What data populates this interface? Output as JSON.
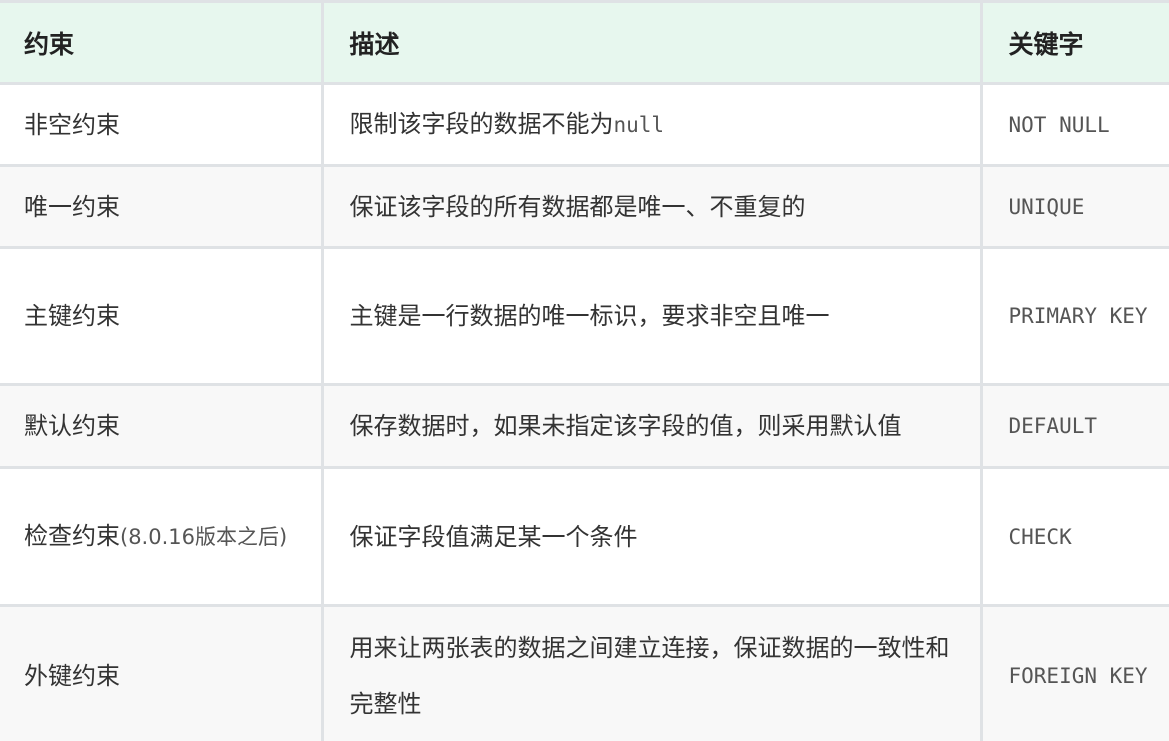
{
  "table": {
    "headers": {
      "constraint": "约束",
      "description": "描述",
      "keyword": "关键字"
    },
    "rows": [
      {
        "name": "非空约束",
        "name_note": "",
        "description": "限制该字段的数据不能为",
        "description_code": "null",
        "keyword": "NOT NULL"
      },
      {
        "name": "唯一约束",
        "name_note": "",
        "description": "保证该字段的所有数据都是唯一、不重复的",
        "description_code": "",
        "keyword": "UNIQUE"
      },
      {
        "name": "主键约束",
        "name_note": "",
        "description": "主键是一行数据的唯一标识，要求非空且唯一",
        "description_code": "",
        "keyword": "PRIMARY KEY"
      },
      {
        "name": "默认约束",
        "name_note": "",
        "description": "保存数据时，如果未指定该字段的值，则采用默认值",
        "description_code": "",
        "keyword": "DEFAULT"
      },
      {
        "name": "检查约束",
        "name_note": "(8.0.16版本之后)",
        "description": "保证字段值满足某一个条件",
        "description_code": "",
        "keyword": "CHECK"
      },
      {
        "name": "外键约束",
        "name_note": "",
        "description": "用来让两张表的数据之间建立连接，保证数据的一致性和完整性",
        "description_code": "",
        "keyword": "FOREIGN KEY"
      }
    ]
  }
}
